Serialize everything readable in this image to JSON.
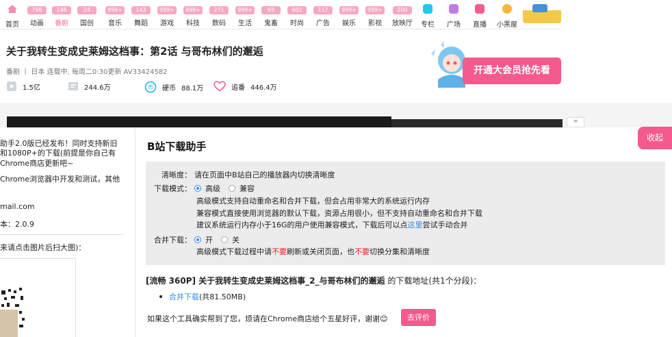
{
  "nav": {
    "items": [
      {
        "badge": "",
        "label": "首页",
        "icon": "home-icon",
        "active": false
      },
      {
        "badge": "798",
        "label": "动画",
        "icon": "",
        "active": false
      },
      {
        "badge": "148",
        "label": "番剧",
        "icon": "",
        "active": true
      },
      {
        "badge": "24",
        "label": "国创",
        "icon": "",
        "active": false
      },
      {
        "badge": "999+",
        "label": "音乐",
        "icon": "",
        "active": false
      },
      {
        "badge": "143",
        "label": "舞蹈",
        "icon": "",
        "active": false
      },
      {
        "badge": "999+",
        "label": "游戏",
        "icon": "",
        "active": false
      },
      {
        "badge": "999+",
        "label": "科技",
        "icon": "",
        "active": false
      },
      {
        "badge": "271",
        "label": "数码",
        "icon": "",
        "active": false
      },
      {
        "badge": "999+",
        "label": "生活",
        "icon": "",
        "active": false
      },
      {
        "badge": "69",
        "label": "鬼畜",
        "icon": "",
        "active": false
      },
      {
        "badge": "602",
        "label": "时尚",
        "icon": "",
        "active": false
      },
      {
        "badge": "117",
        "label": "广告",
        "icon": "",
        "active": false
      },
      {
        "badge": "999+",
        "label": "娱乐",
        "icon": "",
        "active": false
      },
      {
        "badge": "999+",
        "label": "影视",
        "icon": "",
        "active": false
      },
      {
        "badge": "200",
        "label": "放映厅",
        "icon": "",
        "active": false
      },
      {
        "badge": "",
        "label": "专栏",
        "icon": "column-icon",
        "active": false
      },
      {
        "badge": "",
        "label": "广场",
        "icon": "square-icon",
        "active": false
      },
      {
        "badge": "",
        "label": "直播",
        "icon": "live-icon",
        "active": false
      },
      {
        "badge": "",
        "label": "小黑屋",
        "icon": "blackroom-icon",
        "active": false
      }
    ]
  },
  "video": {
    "title": "关于我转生变成史莱姆这档事：第2话 与哥布林们的邂逅",
    "meta": "番剧 丨 日本  连载中, 每周二0:30更新  AV33424582",
    "stats": {
      "plays": "1.5亿",
      "danmaku": "244.6万",
      "coins_label": "硬币",
      "coins": "88.1万",
      "follow_label": "追番",
      "follow": "446.4万"
    },
    "vip_button": "开通大会员抢先看"
  },
  "left_panel": {
    "line1": "助手2.0版已经发布！同时支持新旧",
    "line2": "和1080P+的下载(前提是你自己有",
    "line3": "Chrome商店更新吧~",
    "line4": "Chrome浏览器中开发和测试，其他",
    "line5": "mail.com",
    "line6": "本：2.0.9",
    "line7": "来请点击图片后扫大图)："
  },
  "helper": {
    "title": "B站下载助手",
    "collapse": "收起",
    "quality_label": "清晰度：",
    "quality_text": "请在页面中B站自己的播放器内切换清晰度",
    "mode_label": "下载模式：",
    "mode_opt_advanced": "高级",
    "mode_opt_compat": "兼容",
    "mode_desc1": "高级模式支持自动重命名和合并下载，但会占用非常大的系统运行内存",
    "mode_desc2": "兼容模式直接使用浏览器的默认下载，资源占用很小，但不支持自动重命名和合并下载",
    "mode_desc3_pre": "建议系统运行内存小于16G的用户使用兼容模式，下载后可以点",
    "mode_desc3_link": "这里",
    "mode_desc3_post": "尝试手动合并",
    "merge_label": "合并下载：",
    "merge_on": "开",
    "merge_off": "关",
    "merge_desc_1": "高级模式下载过程中请",
    "merge_desc_red1": "不要",
    "merge_desc_2": "刷新或关闭页面，也",
    "merge_desc_red2": "不要",
    "merge_desc_3": "切换分集和清晰度",
    "dl_title_bold": "[流畅 360P] 关于我转生变成史莱姆这档事_2_与哥布林们的邂逅",
    "dl_title_rest": " 的下载地址(共1个分段)：",
    "dl_link": "合并下载",
    "dl_size": " (共81.50MB)",
    "footer": "如果这个工具确实帮到了您，烦请在Chrome商店给个五星好评，谢谢😊",
    "review_btn": "去评价"
  }
}
